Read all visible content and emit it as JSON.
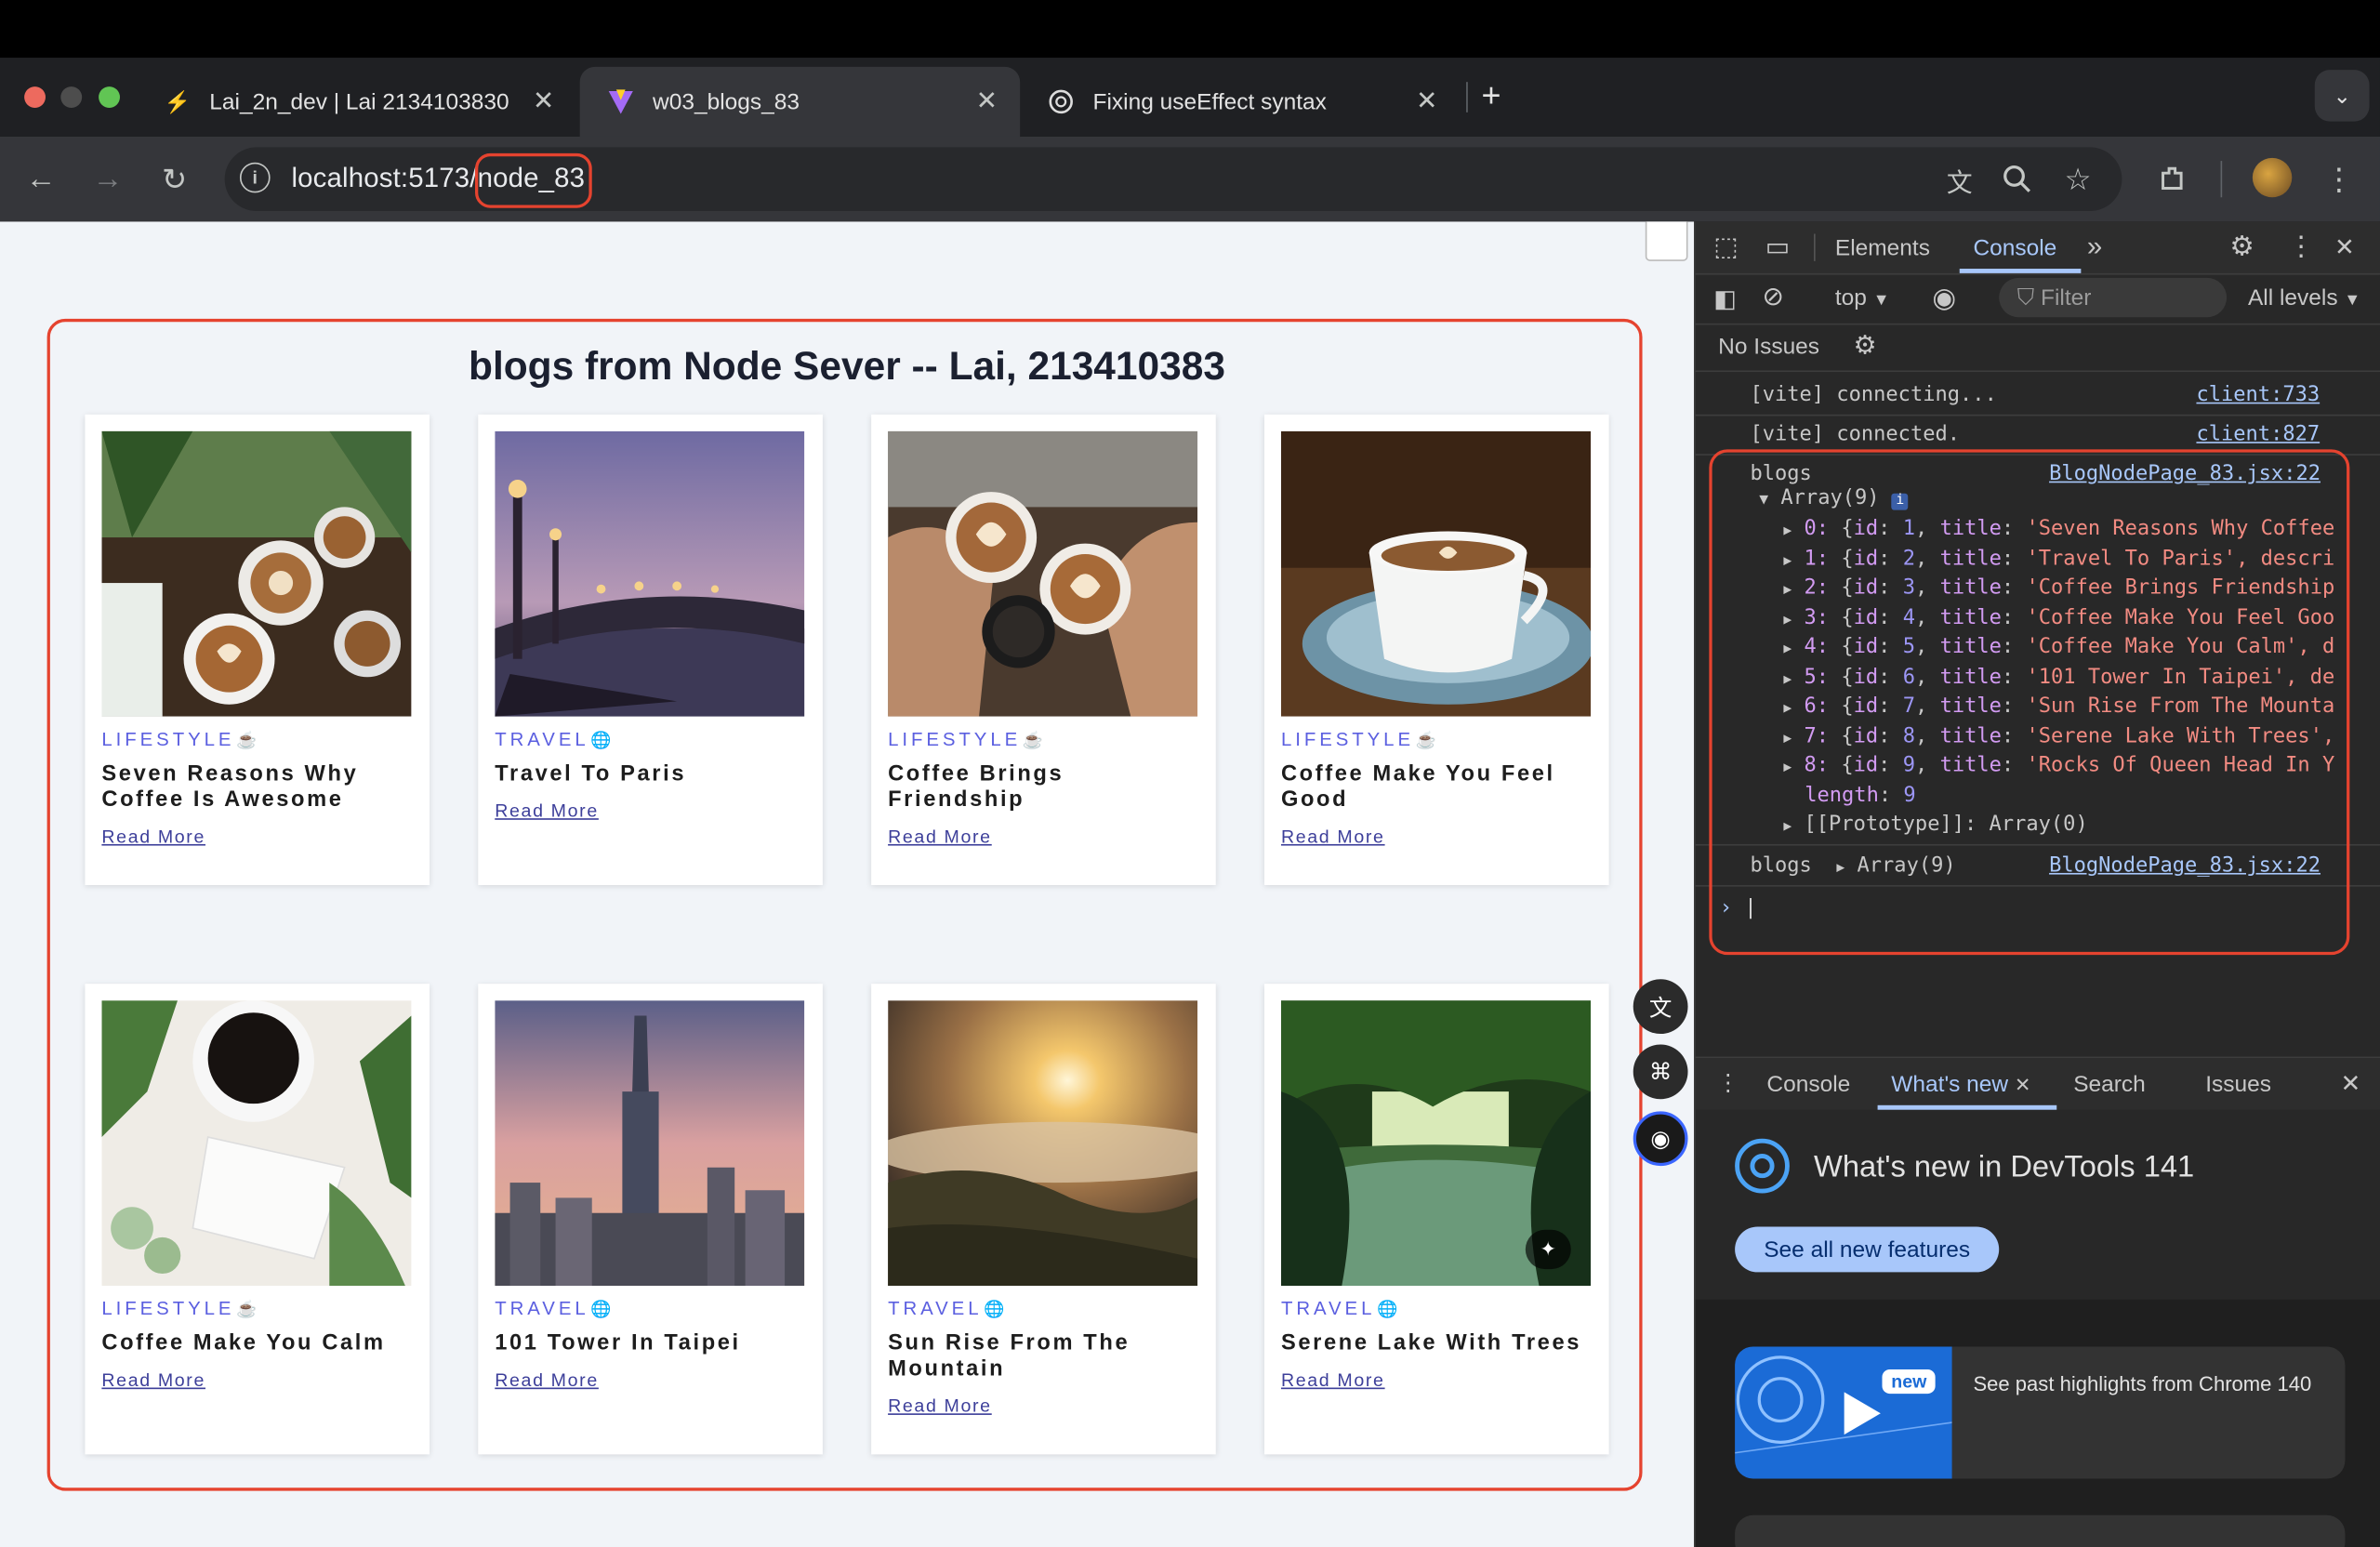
{
  "browser": {
    "tabs": [
      {
        "title": "Lai_2n_dev | Lai 2134103830",
        "icon": "bolt-icon"
      },
      {
        "title": "w03_blogs_83",
        "icon": "vite-icon"
      },
      {
        "title": "Fixing useEffect syntax",
        "icon": "openai-icon"
      }
    ],
    "url": "localhost:5173/node_83"
  },
  "page": {
    "heading": "blogs from Node Sever -- Lai, 213410383",
    "read_more": "Read More",
    "cards": [
      {
        "category": "LIFESTYLE",
        "cat_icon": "☕",
        "title": "Seven Reasons Why Coffee Is Awesome"
      },
      {
        "category": "TRAVEL",
        "cat_icon": "🌐",
        "title": "Travel To Paris"
      },
      {
        "category": "LIFESTYLE",
        "cat_icon": "☕",
        "title": "Coffee Brings Friendship"
      },
      {
        "category": "LIFESTYLE",
        "cat_icon": "☕",
        "title": "Coffee Make You Feel Good"
      },
      {
        "category": "LIFESTYLE",
        "cat_icon": "☕",
        "title": "Coffee Make You Calm"
      },
      {
        "category": "TRAVEL",
        "cat_icon": "🌐",
        "title": "101 Tower In Taipei"
      },
      {
        "category": "TRAVEL",
        "cat_icon": "🌐",
        "title": "Sun Rise From The Mountain"
      },
      {
        "category": "TRAVEL",
        "cat_icon": "🌐",
        "title": "Serene Lake With Trees"
      }
    ]
  },
  "devtools": {
    "tabs": {
      "elements": "Elements",
      "console": "Console"
    },
    "context": "top",
    "filter_placeholder": "Filter",
    "levels": "All levels",
    "issues": "No Issues",
    "logs": [
      {
        "text": "[vite] connecting...",
        "source": "client:733"
      },
      {
        "text": "[vite] connected.",
        "source": "client:827"
      }
    ],
    "blogs_label": "blogs",
    "blogs_source": "BlogNodePage_83.jsx:22",
    "array_label": "Array(9)",
    "items": [
      {
        "idx": "0:",
        "id": "1",
        "title": "'Seven Reasons Why Coffee"
      },
      {
        "idx": "1:",
        "id": "2",
        "title": "'Travel To Paris', descri"
      },
      {
        "idx": "2:",
        "id": "3",
        "title": "'Coffee Brings Friendship"
      },
      {
        "idx": "3:",
        "id": "4",
        "title": "'Coffee Make You Feel Goo"
      },
      {
        "idx": "4:",
        "id": "5",
        "title": "'Coffee Make You Calm', d"
      },
      {
        "idx": "5:",
        "id": "6",
        "title": "'101 Tower In Taipei', de"
      },
      {
        "idx": "6:",
        "id": "7",
        "title": "'Sun Rise From The Mounta"
      },
      {
        "idx": "7:",
        "id": "8",
        "title": "'Serene Lake With Trees',"
      },
      {
        "idx": "8:",
        "id": "9",
        "title": "'Rocks Of Queen Head In Y"
      }
    ],
    "length_key": "length",
    "length_val": "9",
    "prototype": "[[Prototype]]: Array(0)",
    "drawer_tabs": {
      "console": "Console",
      "whats_new": "What's new",
      "search": "Search",
      "issues": "Issues"
    },
    "whats_new_title": "What's new in DevTools 141",
    "see_all": "See all new features",
    "new_badge": "new",
    "highlights": "See past highlights from Chrome 140"
  }
}
